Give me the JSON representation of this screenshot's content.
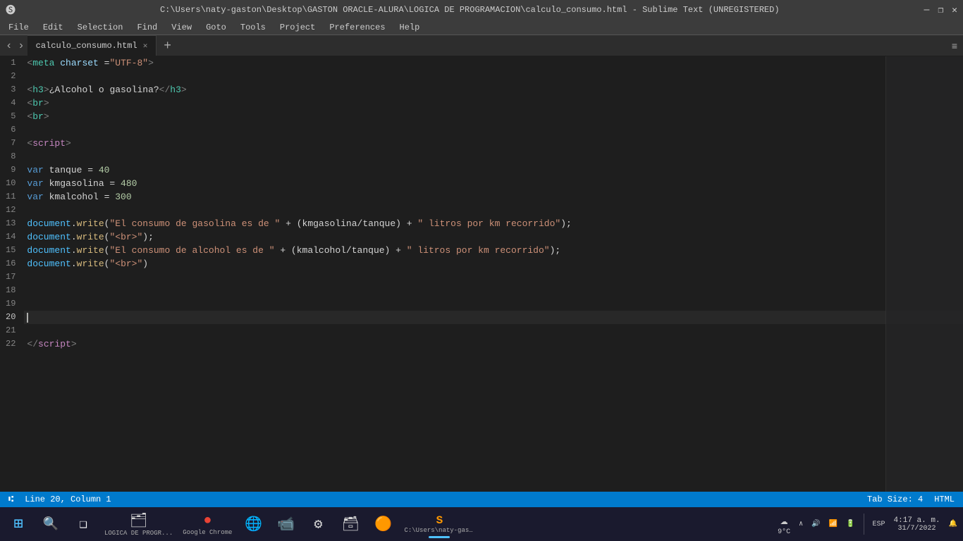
{
  "titlebar": {
    "title": "C:\\Users\\naty-gaston\\Desktop\\GASTON ORACLE-ALURA\\LOGICA DE PROGRAMACION\\calculo_consumo.html - Sublime Text (UNREGISTERED)",
    "min": "─",
    "max": "❐",
    "close": "✕"
  },
  "menubar": {
    "items": [
      "File",
      "Edit",
      "Selection",
      "Find",
      "View",
      "Goto",
      "Tools",
      "Project",
      "Preferences",
      "Help"
    ]
  },
  "tabbar": {
    "tab_name": "calculo_consumo.html",
    "add_label": "+",
    "options_label": "≡"
  },
  "statusbar": {
    "branch_icon": "⑆",
    "line_col": "Line 20, Column 1",
    "tab_size": "Tab Size: 4",
    "language": "HTML"
  },
  "taskbar": {
    "start_icon": "⊞",
    "search_icon": "🔍",
    "taskview_icon": "❑",
    "items": [
      {
        "icon": "🗂",
        "label": "LOGICA DE PROGR...",
        "active": false
      },
      {
        "icon": "🌐",
        "label": "Google Chrome",
        "active": false
      },
      {
        "icon": "🌐",
        "label": "Edge",
        "active": false
      },
      {
        "icon": "📹",
        "label": "Zoom",
        "active": false
      },
      {
        "icon": "⚙",
        "label": "Settings",
        "active": false
      },
      {
        "icon": "🗃",
        "label": "Files",
        "active": false
      },
      {
        "icon": "🟠",
        "label": "App",
        "active": false
      },
      {
        "icon": "S",
        "label": "C:\\Users\\naty-gast...",
        "active": true
      }
    ],
    "system": {
      "weather": "☁",
      "temp": "9°C",
      "tray_icons": "∧  🔊  📶  🔋",
      "lang": "ESP",
      "time": "4:17 a. m.",
      "date": "31/7/2022",
      "notif_icon": "🔔"
    }
  },
  "editor": {
    "lines": [
      {
        "num": 1,
        "tokens": [
          {
            "t": "tag",
            "v": "<"
          },
          {
            "t": "tagname",
            "v": "meta"
          },
          {
            "t": "attr",
            "v": " charset"
          },
          {
            "t": "op",
            "v": " ="
          },
          {
            "t": "val",
            "v": "\"UTF-8\""
          },
          {
            "t": "tag",
            "v": ">"
          }
        ]
      },
      {
        "num": 2,
        "tokens": []
      },
      {
        "num": 3,
        "tokens": [
          {
            "t": "tag",
            "v": "<"
          },
          {
            "t": "tagname",
            "v": "h3"
          },
          {
            "t": "tag",
            "v": ">"
          },
          {
            "t": "plain",
            "v": "¿Alcohol o gasolina?"
          },
          {
            "t": "tag",
            "v": "</"
          },
          {
            "t": "tagname",
            "v": "h3"
          },
          {
            "t": "tag",
            "v": ">"
          }
        ]
      },
      {
        "num": 4,
        "tokens": [
          {
            "t": "tag",
            "v": "<"
          },
          {
            "t": "tagname",
            "v": "br"
          },
          {
            "t": "tag",
            "v": ">"
          }
        ]
      },
      {
        "num": 5,
        "tokens": [
          {
            "t": "tag",
            "v": "<"
          },
          {
            "t": "tagname",
            "v": "br"
          },
          {
            "t": "tag",
            "v": ">"
          }
        ]
      },
      {
        "num": 6,
        "tokens": []
      },
      {
        "num": 7,
        "tokens": [
          {
            "t": "tag",
            "v": "<"
          },
          {
            "t": "script",
            "v": "script"
          },
          {
            "t": "tag",
            "v": ">"
          }
        ]
      },
      {
        "num": 8,
        "tokens": []
      },
      {
        "num": 9,
        "tokens": [
          {
            "t": "kw",
            "v": "var"
          },
          {
            "t": "plain",
            "v": " tanque = "
          },
          {
            "t": "num",
            "v": "40"
          }
        ]
      },
      {
        "num": 10,
        "tokens": [
          {
            "t": "kw",
            "v": "var"
          },
          {
            "t": "plain",
            "v": " kmgasolina = "
          },
          {
            "t": "num",
            "v": "480"
          }
        ]
      },
      {
        "num": 11,
        "tokens": [
          {
            "t": "kw",
            "v": "var"
          },
          {
            "t": "plain",
            "v": " kmalcohol = "
          },
          {
            "t": "num",
            "v": "300"
          }
        ]
      },
      {
        "num": 12,
        "tokens": []
      },
      {
        "num": 13,
        "tokens": [
          {
            "t": "obj",
            "v": "document"
          },
          {
            "t": "plain",
            "v": "."
          },
          {
            "t": "prop",
            "v": "write"
          },
          {
            "t": "plain",
            "v": "("
          },
          {
            "t": "str",
            "v": "\"El consumo de gasolina es de \""
          },
          {
            "t": "plain",
            "v": " + (kmgasolina/tanque) + "
          },
          {
            "t": "str",
            "v": "\" litros por km recorrido\""
          },
          {
            "t": "plain",
            "v": ");"
          }
        ]
      },
      {
        "num": 14,
        "tokens": [
          {
            "t": "obj",
            "v": "document"
          },
          {
            "t": "plain",
            "v": "."
          },
          {
            "t": "prop",
            "v": "write"
          },
          {
            "t": "plain",
            "v": "("
          },
          {
            "t": "str",
            "v": "\"<br>\""
          },
          {
            "t": "plain",
            "v": ");"
          }
        ]
      },
      {
        "num": 15,
        "tokens": [
          {
            "t": "obj",
            "v": "document"
          },
          {
            "t": "plain",
            "v": "."
          },
          {
            "t": "prop",
            "v": "write"
          },
          {
            "t": "plain",
            "v": "("
          },
          {
            "t": "str",
            "v": "\"El consumo de alcohol es de \""
          },
          {
            "t": "plain",
            "v": " + (kmalcohol/tanque) + "
          },
          {
            "t": "str",
            "v": "\" litros por km recorrido\""
          },
          {
            "t": "plain",
            "v": ");"
          }
        ]
      },
      {
        "num": 16,
        "tokens": [
          {
            "t": "obj",
            "v": "document"
          },
          {
            "t": "plain",
            "v": "."
          },
          {
            "t": "prop",
            "v": "write"
          },
          {
            "t": "plain",
            "v": "("
          },
          {
            "t": "str",
            "v": "\"<br>\""
          },
          {
            "t": "plain",
            "v": ")"
          }
        ]
      },
      {
        "num": 17,
        "tokens": []
      },
      {
        "num": 18,
        "tokens": []
      },
      {
        "num": 19,
        "tokens": []
      },
      {
        "num": 20,
        "tokens": [],
        "active": true,
        "cursor": true
      },
      {
        "num": 21,
        "tokens": []
      },
      {
        "num": 22,
        "tokens": [
          {
            "t": "tag",
            "v": "</"
          },
          {
            "t": "script",
            "v": "script"
          },
          {
            "t": "tag",
            "v": ">"
          }
        ]
      }
    ]
  }
}
